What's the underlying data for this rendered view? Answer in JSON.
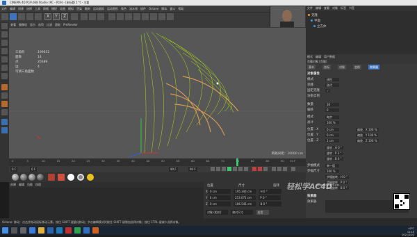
{
  "window": {
    "title": "CINEMA 4D R19.068 Studio (RC - R19) - [未标题 1 *] - 主要"
  },
  "menubar": {
    "items": [
      "文件",
      "编辑",
      "创建",
      "选择",
      "工具",
      "网格",
      "捕捉",
      "动画",
      "模拟",
      "渲染",
      "雕刻",
      "运动跟踪",
      "运动图形",
      "角色",
      "流水线",
      "插件",
      "Octane",
      "脚本",
      "窗口",
      "帮助"
    ]
  },
  "toolbar": {
    "x_label": "X",
    "y_label": "Y",
    "z_label": "Z"
  },
  "viewport_menu": {
    "items": [
      "查看",
      "摄像机",
      "显示",
      "选项",
      "过滤",
      "面板",
      "ProRender"
    ]
  },
  "hud": {
    "rows": [
      {
        "label": "三角形",
        "value": "199632"
      },
      {
        "label": "面数",
        "value": "14"
      },
      {
        "label": "点",
        "value": "20389"
      },
      {
        "label": "边",
        "value": "4"
      },
      {
        "label": "可调三角面数",
        "value": ""
      }
    ]
  },
  "viewport": {
    "grid_scale": "网格间距：10000 cm",
    "accent": "#c8ff00"
  },
  "timeline": {
    "ticks": [
      "0",
      "5",
      "10",
      "15",
      "20",
      "25",
      "30",
      "35",
      "40",
      "45",
      "50",
      "55",
      "60",
      "65",
      "70",
      "75",
      "80",
      "85",
      "90"
    ],
    "end_label": "70 F",
    "playhead_frame": 65
  },
  "playbar": {
    "start": "0 F",
    "current": "0 F",
    "end": "90 F",
    "end2": "90 F"
  },
  "material_menu": {
    "items": [
      "创建",
      "编辑",
      "功能",
      "纹理"
    ]
  },
  "coords": {
    "headers": [
      "位置",
      "尺寸",
      "旋转"
    ],
    "rows": [
      {
        "axis": "X",
        "pos": "0 cm",
        "size": "195.344 cm",
        "rot": "H 0 °"
      },
      {
        "axis": "Y",
        "pos": "0 cm",
        "size": "253.071 cm",
        "rot": "P 0 °"
      },
      {
        "axis": "Z",
        "pos": "0 cm",
        "size": "186.541 cm",
        "rot": "B 0 °"
      }
    ],
    "mode": "对象 (相对)",
    "size_mode": "绝对尺寸",
    "apply": "应用"
  },
  "statusbar": {
    "text": "Octane: 移动：点击并拖动鼠标移动元素。按住 SHIFT 键量化移动；节点编辑模式时按住 SHIFT 键增加选择对象；按住 CTRL 键减少选择对象。"
  },
  "right_menu": {
    "items": [
      "文件",
      "编辑",
      "查看",
      "对象",
      "标签",
      "书签"
    ],
    "layout": "界面：启动 (用户)"
  },
  "objects": [
    {
      "name": "克隆",
      "color": "#e0a020"
    },
    {
      "name": "平面",
      "color": "#3fa0e0"
    },
    {
      "name": "立方体",
      "color": "#3fa0e0"
    }
  ],
  "attr_header": {
    "items": [
      "模式",
      "编辑",
      "用户数据"
    ],
    "object_title": "克隆对象 [克隆]"
  },
  "attr_tabs": {
    "items": [
      "基本",
      "坐标",
      "对象",
      "变换",
      "效果器"
    ],
    "selected": 4
  },
  "props": {
    "section_object": "对象属性",
    "mode_label": "模式",
    "mode_value": "线性",
    "clones_label": "克隆",
    "clones_value": "迭代",
    "fix_label": "固定克隆",
    "fix_value": "✓",
    "render_label": "渲染实例",
    "count_label": "数量",
    "count_value": "30",
    "offset_label": "偏移",
    "offset_value": "0",
    "mode2_label": "模式",
    "mode2_value": "每步",
    "total_label": "总计",
    "total_value": "100 %",
    "pos_x_label": "位置 . X",
    "pos_x_value": "0 cm",
    "pos_y_label": "位置 . Y",
    "pos_y_value": "0 cm",
    "pos_z_label": "位置 . Z",
    "pos_z_value": "1 cm",
    "scale_x": "缩放 . X 100 %",
    "scale_y": "缩放 . Y 100 %",
    "scale_z": "缩放 . Z 100 %",
    "rot_h": "旋转 . H 0 °",
    "rot_p": "旋转 . P 3 °",
    "rot_b": "旋转 . B 0 °",
    "step_mode_label": "步幅模式",
    "step_mode_value": "单一值",
    "step_size_label": "步幅尺寸",
    "step_size_value": "100 %",
    "step_rot_h": "步幅旋转 . H 0 °",
    "step_rot_p": "步幅旋转 . P 0 °",
    "step_rot_b": "步幅旋转 . B 0 °",
    "section_effector": "效果器",
    "effector_label": "效果器"
  },
  "watermark": {
    "brand": "轻松学AC4D",
    "url": "www.tvart.cn"
  },
  "taskbar": {
    "time": "11:15",
    "date": "2021/10/2",
    "temp": "40°C"
  }
}
